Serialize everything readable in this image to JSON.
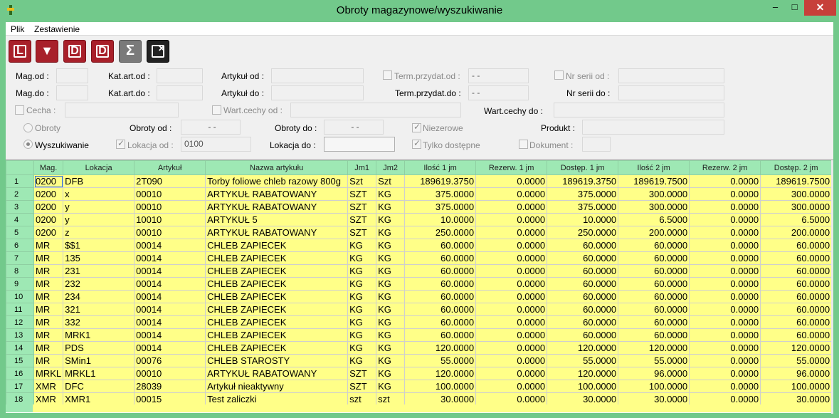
{
  "window": {
    "title": "Obroty magazynowe/wyszukiwanie",
    "minimize": "–",
    "maximize": "□",
    "close": "✕"
  },
  "menu": {
    "items": [
      "Plik",
      "Zestawienie"
    ]
  },
  "toolbar": {
    "buttons": [
      {
        "glyph": "L",
        "icon": "print-list-icon",
        "color": "#a8202a"
      },
      {
        "glyph": "▼",
        "icon": "filter-icon",
        "color": "#a8202a"
      },
      {
        "glyph": "D",
        "icon": "print-detail-icon",
        "color": "#a8202a"
      },
      {
        "glyph": "D",
        "icon": "print-detail-alt-icon",
        "color": "#a8202a"
      },
      {
        "glyph": "Σ",
        "icon": "sum-icon",
        "color": "#7a7a7a"
      },
      {
        "glyph": "✕",
        "icon": "close-document-icon",
        "color": "#222222"
      }
    ]
  },
  "filters": {
    "mag_od": {
      "label": "Mag.od :",
      "value": ""
    },
    "mag_do": {
      "label": "Mag.do :",
      "value": ""
    },
    "katart_od": {
      "label": "Kat.art.od :",
      "value": ""
    },
    "katart_do": {
      "label": "Kat.art.do :",
      "value": ""
    },
    "artykul_od": {
      "label": "Artykuł od :",
      "value": ""
    },
    "artykul_do": {
      "label": "Artykuł do :",
      "value": ""
    },
    "term_od": {
      "label": "Term.przydat.od :",
      "value": " -  -"
    },
    "term_do": {
      "label": "Term.przydat.do :",
      "value": " -  -"
    },
    "nrserii_od": {
      "label": "Nr serii od :",
      "value": ""
    },
    "nrserii_do": {
      "label": "Nr serii do :",
      "value": ""
    },
    "cecha": {
      "label": "Cecha :",
      "value": ""
    },
    "wartcechy_od": {
      "label": "Wart.cechy od :",
      "value": ""
    },
    "wartcechy_do": {
      "label": "Wart.cechy do :",
      "value": ""
    },
    "obroty_radio": {
      "label": "Obroty",
      "checked": false
    },
    "wyszukiwanie_radio": {
      "label": "Wyszukiwanie",
      "checked": true
    },
    "obroty_od": {
      "label": "Obroty od :",
      "value": " -  -"
    },
    "obroty_do": {
      "label": "Obroty do :",
      "value": " -  -"
    },
    "niezerowe": {
      "label": "Niezerowe",
      "checked": true
    },
    "produkt": {
      "label": "Produkt :",
      "value": ""
    },
    "lokacja_od": {
      "label": "Lokacja od :",
      "value": "0100",
      "checked": true
    },
    "lokacja_do": {
      "label": "Lokacja do :",
      "value": ""
    },
    "tylko_dostepne": {
      "label": "Tylko dostępne",
      "checked": true
    },
    "dokument": {
      "label": "Dokument :",
      "value": "",
      "checked": false
    }
  },
  "grid": {
    "columns": [
      "Mag.",
      "Lokacja",
      "Artykuł",
      "Nazwa artykułu",
      "Jm1",
      "Jm2",
      "Ilość 1 jm",
      "Rezerw. 1 jm",
      "Dostęp. 1 jm",
      "Ilość 2 jm",
      "Rezerw. 2 jm",
      "Dostęp. 2 jm"
    ],
    "rows": [
      [
        "1",
        "0200",
        "DFB",
        "2T090",
        "Torby foliowe chleb razowy 800g",
        "Szt",
        "Szt",
        "189619.3750",
        "0.0000",
        "189619.3750",
        "189619.7500",
        "0.0000",
        "189619.7500"
      ],
      [
        "2",
        "0200",
        "x",
        "00010",
        "ARTYKUŁ RABATOWANY",
        "SZT",
        "KG",
        "375.0000",
        "0.0000",
        "375.0000",
        "300.0000",
        "0.0000",
        "300.0000"
      ],
      [
        "3",
        "0200",
        "y",
        "00010",
        "ARTYKUŁ RABATOWANY",
        "SZT",
        "KG",
        "375.0000",
        "0.0000",
        "375.0000",
        "300.0000",
        "0.0000",
        "300.0000"
      ],
      [
        "4",
        "0200",
        "y",
        "10010",
        "ARTYKUŁ 5",
        "SZT",
        "KG",
        "10.0000",
        "0.0000",
        "10.0000",
        "6.5000",
        "0.0000",
        "6.5000"
      ],
      [
        "5",
        "0200",
        "z",
        "00010",
        "ARTYKUŁ RABATOWANY",
        "SZT",
        "KG",
        "250.0000",
        "0.0000",
        "250.0000",
        "200.0000",
        "0.0000",
        "200.0000"
      ],
      [
        "6",
        "MR",
        "$$1",
        "00014",
        "CHLEB ZAPIECEK",
        "KG",
        "KG",
        "60.0000",
        "0.0000",
        "60.0000",
        "60.0000",
        "0.0000",
        "60.0000"
      ],
      [
        "7",
        "MR",
        "135",
        "00014",
        "CHLEB ZAPIECEK",
        "KG",
        "KG",
        "60.0000",
        "0.0000",
        "60.0000",
        "60.0000",
        "0.0000",
        "60.0000"
      ],
      [
        "8",
        "MR",
        "231",
        "00014",
        "CHLEB ZAPIECEK",
        "KG",
        "KG",
        "60.0000",
        "0.0000",
        "60.0000",
        "60.0000",
        "0.0000",
        "60.0000"
      ],
      [
        "9",
        "MR",
        "232",
        "00014",
        "CHLEB ZAPIECEK",
        "KG",
        "KG",
        "60.0000",
        "0.0000",
        "60.0000",
        "60.0000",
        "0.0000",
        "60.0000"
      ],
      [
        "10",
        "MR",
        "234",
        "00014",
        "CHLEB ZAPIECEK",
        "KG",
        "KG",
        "60.0000",
        "0.0000",
        "60.0000",
        "60.0000",
        "0.0000",
        "60.0000"
      ],
      [
        "11",
        "MR",
        "321",
        "00014",
        "CHLEB ZAPIECEK",
        "KG",
        "KG",
        "60.0000",
        "0.0000",
        "60.0000",
        "60.0000",
        "0.0000",
        "60.0000"
      ],
      [
        "12",
        "MR",
        "332",
        "00014",
        "CHLEB ZAPIECEK",
        "KG",
        "KG",
        "60.0000",
        "0.0000",
        "60.0000",
        "60.0000",
        "0.0000",
        "60.0000"
      ],
      [
        "13",
        "MR",
        "MRK1",
        "00014",
        "CHLEB ZAPIECEK",
        "KG",
        "KG",
        "60.0000",
        "0.0000",
        "60.0000",
        "60.0000",
        "0.0000",
        "60.0000"
      ],
      [
        "14",
        "MR",
        "PDS",
        "00014",
        "CHLEB ZAPIECEK",
        "KG",
        "KG",
        "120.0000",
        "0.0000",
        "120.0000",
        "120.0000",
        "0.0000",
        "120.0000"
      ],
      [
        "15",
        "MR",
        "SMin1",
        "00076",
        "CHLEB STAROSTY",
        "KG",
        "KG",
        "55.0000",
        "0.0000",
        "55.0000",
        "55.0000",
        "0.0000",
        "55.0000"
      ],
      [
        "16",
        "MRKL",
        "MRKL1",
        "00010",
        "ARTYKUŁ RABATOWANY",
        "SZT",
        "KG",
        "120.0000",
        "0.0000",
        "120.0000",
        "96.0000",
        "0.0000",
        "96.0000"
      ],
      [
        "17",
        "XMR",
        "DFC",
        "28039",
        "Artykuł nieaktywny",
        "SZT",
        "KG",
        "100.0000",
        "0.0000",
        "100.0000",
        "100.0000",
        "0.0000",
        "100.0000"
      ],
      [
        "18",
        "XMR",
        "XMR1",
        "00015",
        "Test zaliczki",
        "szt",
        "szt",
        "30.0000",
        "0.0000",
        "30.0000",
        "30.0000",
        "0.0000",
        "30.0000"
      ]
    ]
  }
}
